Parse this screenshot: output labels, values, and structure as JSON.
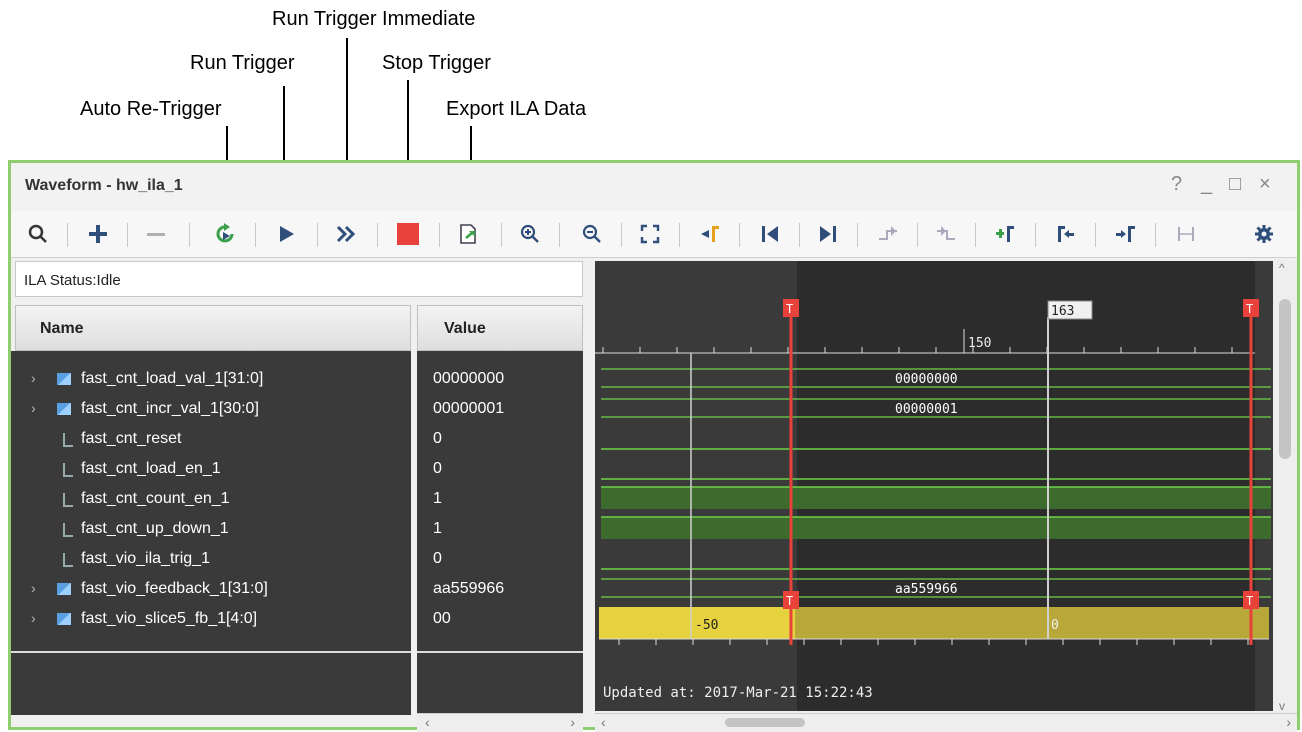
{
  "callouts": {
    "auto_retrigger": "Auto Re-Trigger",
    "run_trigger": "Run Trigger",
    "run_trigger_immediate": "Run Trigger Immediate",
    "stop_trigger": "Stop Trigger",
    "export_ila": "Export ILA Data"
  },
  "window": {
    "title": "Waveform - hw_ila_1",
    "controls": [
      "?",
      "_",
      "□",
      "×"
    ]
  },
  "toolbar": {
    "icons": [
      "search-icon",
      "add-icon",
      "remove-icon",
      "auto-retrigger-icon",
      "run-trigger-icon",
      "run-trigger-immediate-icon",
      "stop-trigger-icon",
      "export-ila-icon",
      "zoom-in-icon",
      "zoom-out-icon",
      "zoom-fit-icon",
      "goto-cursor-icon",
      "goto-start-icon",
      "goto-end-icon",
      "prev-transition-icon",
      "next-transition-icon",
      "add-marker-icon",
      "prev-marker-icon",
      "next-marker-icon",
      "swap-cursors-icon",
      "settings-icon"
    ]
  },
  "status": "ILA Status:Idle",
  "columns": {
    "name": "Name",
    "value": "Value"
  },
  "signals": [
    {
      "name": "fast_cnt_load_val_1[31:0]",
      "value": "00000000",
      "type": "bus",
      "expandable": true
    },
    {
      "name": "fast_cnt_incr_val_1[30:0]",
      "value": "00000001",
      "type": "bus",
      "expandable": true
    },
    {
      "name": "fast_cnt_reset",
      "value": "0",
      "type": "bit",
      "expandable": false
    },
    {
      "name": "fast_cnt_load_en_1",
      "value": "0",
      "type": "bit",
      "expandable": false
    },
    {
      "name": "fast_cnt_count_en_1",
      "value": "1",
      "type": "bit",
      "expandable": false
    },
    {
      "name": "fast_cnt_up_down_1",
      "value": "1",
      "type": "bit",
      "expandable": false
    },
    {
      "name": "fast_vio_ila_trig_1",
      "value": "0",
      "type": "bit",
      "expandable": false
    },
    {
      "name": "fast_vio_feedback_1[31:0]",
      "value": "aa559966",
      "type": "bus",
      "expandable": true
    },
    {
      "name": "fast_vio_slice5_fb_1[4:0]",
      "value": "00",
      "type": "bus",
      "expandable": true
    }
  ],
  "waveform": {
    "cursor_label": "163",
    "ruler_label": "150",
    "trigger_marker": "T",
    "bus_labels": [
      "00000000",
      "00000001",
      "aa559966"
    ],
    "bottom_labels": [
      "-50",
      "0"
    ],
    "updated": "Updated at: 2017-Mar-21 15:22:43"
  },
  "colors": {
    "accent_border": "#8fce6e",
    "trace": "#6fd24a",
    "trigger": "#e8423a",
    "bottom_bar": "#e6d23e"
  }
}
